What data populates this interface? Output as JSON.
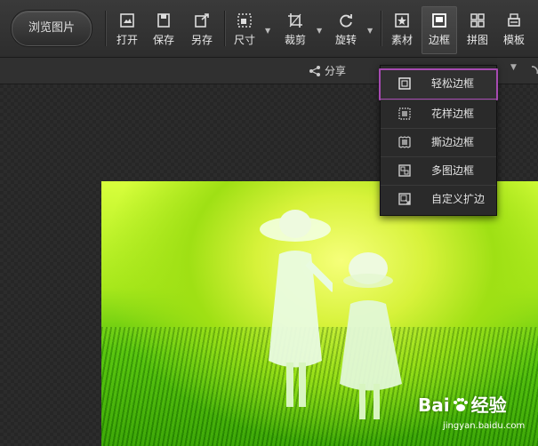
{
  "toolbar": {
    "browse_label": "浏览图片",
    "tools": [
      {
        "label": "打开",
        "icon": "open-icon"
      },
      {
        "label": "保存",
        "icon": "save-icon"
      },
      {
        "label": "另存",
        "icon": "save-as-icon"
      },
      {
        "label": "尺寸",
        "icon": "resize-icon"
      },
      {
        "label": "裁剪",
        "icon": "crop-icon"
      },
      {
        "label": "旋转",
        "icon": "rotate-icon"
      },
      {
        "label": "素材",
        "icon": "material-icon"
      },
      {
        "label": "边框",
        "icon": "border-icon"
      },
      {
        "label": "拼图",
        "icon": "collage-icon"
      },
      {
        "label": "模板",
        "icon": "template-icon"
      }
    ],
    "active": "边框"
  },
  "subbar": {
    "share_label": "分享"
  },
  "border_menu": {
    "items": [
      {
        "label": "轻松边框",
        "icon": "simple-border-icon"
      },
      {
        "label": "花样边框",
        "icon": "pattern-border-icon"
      },
      {
        "label": "撕边边框",
        "icon": "torn-border-icon"
      },
      {
        "label": "多图边框",
        "icon": "multi-image-border-icon"
      },
      {
        "label": "自定义扩边",
        "icon": "custom-extend-icon"
      }
    ],
    "highlighted": "轻松边框"
  },
  "watermark": {
    "text_left": "Bai",
    "text_right": "经验",
    "url": "jingyan.baidu.com"
  },
  "colors": {
    "highlight": "#a64ab1",
    "toolbar_bg": "#333333"
  }
}
